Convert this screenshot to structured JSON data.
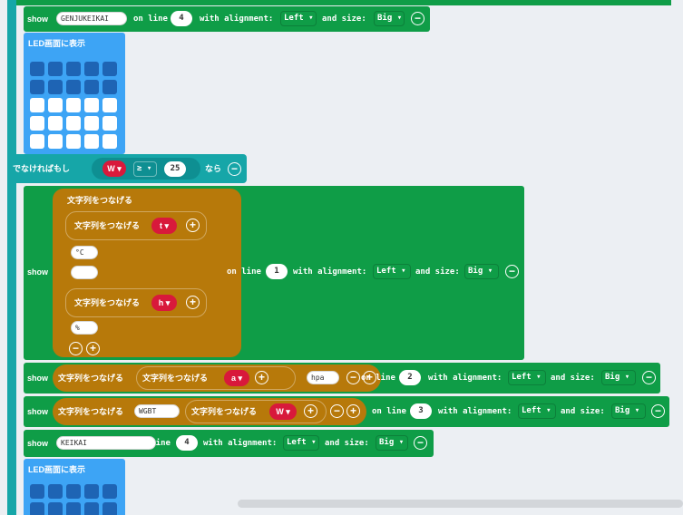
{
  "top_show": {
    "show": "show",
    "text": "GENJUKEIKAI",
    "on_line": "on line",
    "line": "4",
    "with_alignment": "with alignment:",
    "alignment": "Left",
    "and_size": "and size:",
    "size": "Big"
  },
  "led1": {
    "label": "LED画面に表示",
    "grid": [
      [
        0,
        0,
        0,
        0,
        0
      ],
      [
        0,
        0,
        0,
        0,
        0
      ],
      [
        1,
        1,
        1,
        1,
        1
      ],
      [
        1,
        1,
        1,
        1,
        1
      ],
      [
        1,
        1,
        1,
        1,
        1
      ]
    ]
  },
  "else_if": {
    "label": "でなければもし",
    "var": "W",
    "op": "≥",
    "value": "25",
    "then": "なら"
  },
  "show1": {
    "show": "show",
    "join_outer": "文字列をつなげる",
    "join_inner1": "文字列をつなげる",
    "var_t": "t",
    "str_c": "°C",
    "str_space": " ",
    "join_inner2": "文字列をつなげる",
    "var_h": "h",
    "str_pct": "%",
    "on_line": "on line",
    "line": "1",
    "with_alignment": "with alignment:",
    "alignment": "Left",
    "and_size": "and size:",
    "size": "Big"
  },
  "show2": {
    "show": "show",
    "join_outer": "文字列をつなげる",
    "join_inner": "文字列をつなげる",
    "var_a": "a",
    "str_hpa": "hpa",
    "on_line": "on line",
    "line": "2",
    "with_alignment": "with alignment:",
    "alignment": "Left",
    "and_size": "and size:",
    "size": "Big"
  },
  "show3": {
    "show": "show",
    "join_outer": "文字列をつなげる",
    "str_wgbt": "WGBT",
    "join_inner": "文字列をつなげる",
    "var_w": "W",
    "on_line": "on line",
    "line": "3",
    "with_alignment": "with alignment:",
    "alignment": "Left",
    "and_size": "and size:",
    "size": "Big"
  },
  "show4": {
    "show": "show",
    "text": "KEIKAI",
    "on_line": "on line",
    "line": "4",
    "with_alignment": "with alignment:",
    "alignment": "Left",
    "and_size": "and size:",
    "size": "Big"
  },
  "led2": {
    "label": "LED画面に表示"
  },
  "icons": {
    "remove": "minus-circle-icon",
    "add": "plus-circle-icon",
    "dropdown": "caret-down-icon"
  },
  "colors": {
    "led_block": "#3da4f5",
    "logic_block": "#16a6a8",
    "display_block": "#0f9d47",
    "text_block": "#b7790a",
    "variable": "#d8193b",
    "workspace": "#eceff3"
  }
}
